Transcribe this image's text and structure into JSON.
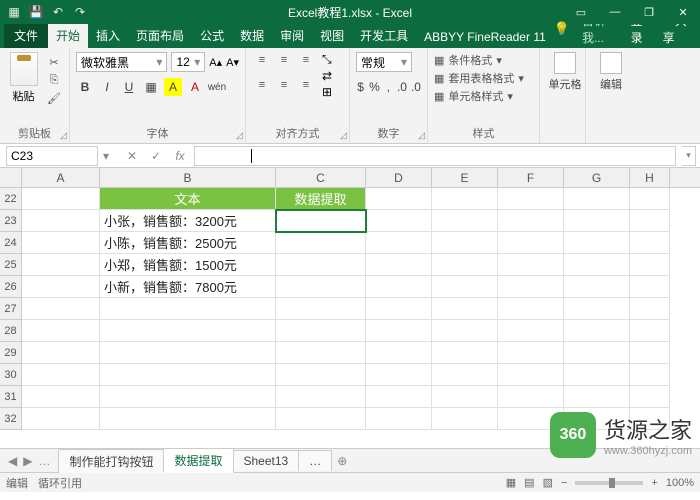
{
  "title": "Excel教程1.xlsx - Excel",
  "tabs": {
    "file": "文件",
    "home": "开始",
    "insert": "插入",
    "layout": "页面布局",
    "formula": "公式",
    "data": "数据",
    "review": "审阅",
    "view": "视图",
    "dev": "开发工具",
    "abbyy": "ABBYY FineReader 11"
  },
  "tellme": "告诉我...",
  "login": "登录",
  "share": "共享",
  "groups": {
    "clipboard": "剪贴板",
    "font": "字体",
    "align": "对齐方式",
    "number": "数字",
    "style": "样式",
    "cells": "单元格",
    "edit": "编辑"
  },
  "paste": "粘贴",
  "fontname": "微软雅黑",
  "fontsize": "12",
  "numfmt": "常规",
  "styles": {
    "cond": "条件格式",
    "tbl": "套用表格格式",
    "cell": "单元格样式"
  },
  "cellsBtn": "单元格",
  "editBtn": "编辑",
  "namebox": "C23",
  "cols": {
    "A": "A",
    "B": "B",
    "C": "C",
    "D": "D",
    "E": "E",
    "F": "F",
    "G": "G",
    "H": "H"
  },
  "rows": [
    "22",
    "23",
    "24",
    "25",
    "26",
    "27",
    "28",
    "29",
    "30",
    "31",
    "32"
  ],
  "headerB": "文本",
  "headerC": "数据提取",
  "dataB": [
    "小张，销售额：3200元",
    "小陈，销售额：2500元",
    "小郑，销售额：1500元",
    "小新，销售额：7800元"
  ],
  "sheets": {
    "s1": "制作能打钩按钮",
    "s2": "数据提取",
    "s3": "Sheet13"
  },
  "status": {
    "edit": "编辑",
    "circ": "循环引用",
    "zoom": "100%"
  },
  "watermark": {
    "badge": "360",
    "top": "货源之家",
    "bot": "www.360hyzj.com"
  }
}
